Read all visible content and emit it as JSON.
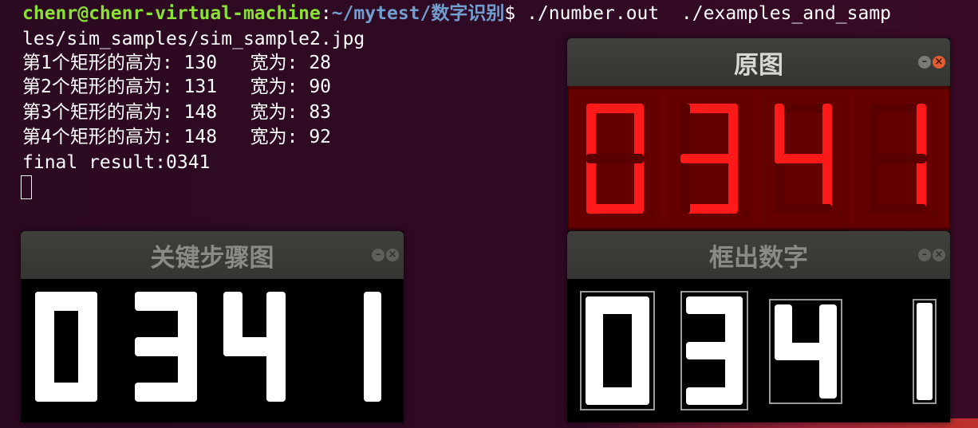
{
  "terminal": {
    "prompt_user": "chenr@chenr-virtual-machine",
    "prompt_sep": ":",
    "prompt_path": "~/mytest/数字识别",
    "prompt_symbol": "$",
    "command": " ./number.out  ./examples_and_samp",
    "lines": [
      "les/sim_samples/sim_sample2.jpg",
      "第1个矩形的高为: 130   宽为: 28",
      "第2个矩形的高为: 131   宽为: 90",
      "第3个矩形的高为: 148   宽为: 83",
      "第4个矩形的高为: 148   宽为: 92",
      "final result:0341"
    ]
  },
  "windows": {
    "original": {
      "title": "原图",
      "digits": "0341",
      "state": "active"
    },
    "key_steps": {
      "title": "关键步骤图",
      "digits": "0341",
      "state": "inactive"
    },
    "boxed": {
      "title": "框出数字",
      "digits": "0341",
      "state": "inactive"
    }
  },
  "colors": {
    "terminal_bg": "#300a24",
    "prompt_user": "#8ae234",
    "prompt_path": "#729fcf",
    "led_on": "#ff1a1a",
    "led_off": "#5a0000",
    "led_panel": "#6a0000",
    "box_outline": "#9a9a9a"
  },
  "icons": {
    "minimize": "minimize-icon",
    "close": "close-icon"
  }
}
